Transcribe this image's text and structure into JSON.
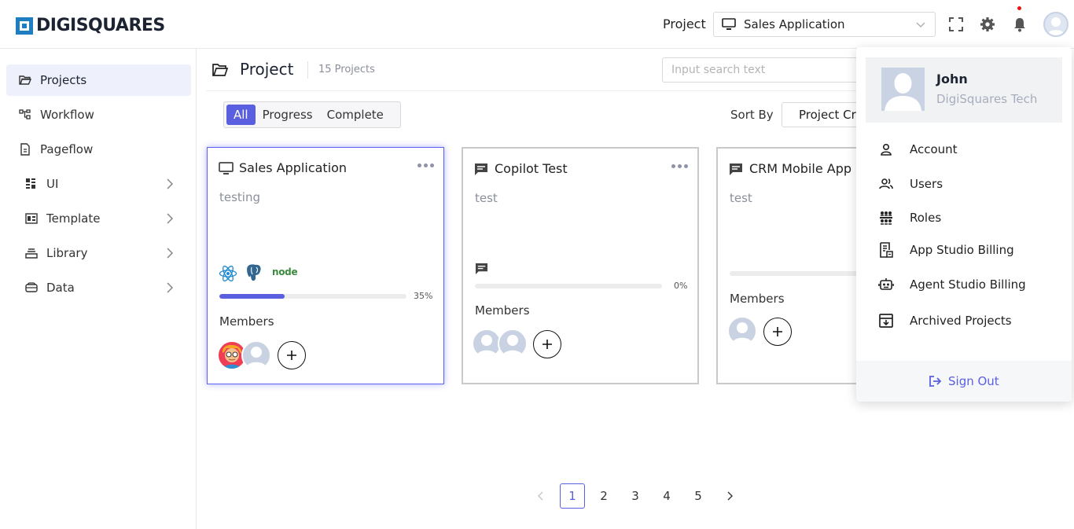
{
  "brand": {
    "name": "DIGISQUARES"
  },
  "header": {
    "project_label": "Project",
    "project_selected": "Sales Application"
  },
  "sidebar": {
    "items": [
      {
        "label": "Projects",
        "active": true,
        "icon": "folder-open-icon"
      },
      {
        "label": "Workflow",
        "icon": "workflow-icon"
      },
      {
        "label": "Pageflow",
        "icon": "pageflow-icon"
      },
      {
        "label": "UI",
        "icon": "ui-grid-icon",
        "expandable": true
      },
      {
        "label": "Template",
        "icon": "template-icon",
        "expandable": true
      },
      {
        "label": "Library",
        "icon": "library-icon",
        "expandable": true
      },
      {
        "label": "Data",
        "icon": "data-icon",
        "expandable": true
      }
    ]
  },
  "main": {
    "title": "Project",
    "count": "15 Projects",
    "search_placeholder": "Input search text",
    "filters": [
      "All",
      "Progress",
      "Complete"
    ],
    "sort_label": "Sort By",
    "sort_value": "Project Created"
  },
  "cards": [
    {
      "title": "Sales Application",
      "description": "testing",
      "progress_pct": 35,
      "progress_text": "35%",
      "members_label": "Members",
      "tech": [
        "react-icon",
        "postgres-icon",
        "node-icon"
      ],
      "tech_node_text": "node"
    },
    {
      "title": "Copilot Test",
      "description": "test",
      "progress_pct": 0,
      "progress_text": "0%",
      "members_label": "Members"
    },
    {
      "title": "CRM Mobile App",
      "description": "test",
      "members_label": "Members"
    }
  ],
  "pagination": {
    "pages": [
      "1",
      "2",
      "3",
      "4",
      "5"
    ],
    "current": "1"
  },
  "user_menu": {
    "name": "John",
    "org": "DigiSquares Tech",
    "items": [
      {
        "label": "Account",
        "icon": "account-icon"
      },
      {
        "label": "Users",
        "icon": "users-icon"
      },
      {
        "label": "Roles",
        "icon": "roles-icon"
      },
      {
        "label": "App Studio Billing",
        "icon": "app-billing-icon"
      },
      {
        "label": "Agent Studio Billing",
        "icon": "agent-billing-icon"
      },
      {
        "label": "Archived Projects",
        "icon": "archive-icon"
      }
    ],
    "sign_out": "Sign Out"
  },
  "colors": {
    "accent": "#5a5fe0",
    "brand": "#1f7dc1",
    "notification": "#e11111"
  }
}
